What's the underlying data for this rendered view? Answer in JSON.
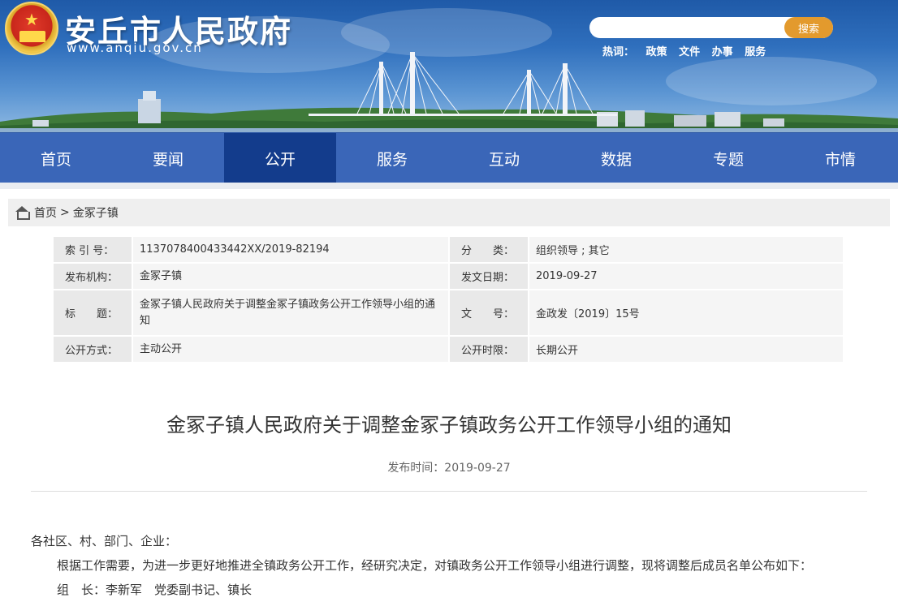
{
  "header": {
    "site_title": "安丘市人民政府",
    "site_url": "www.anqiu.gov.cn",
    "search_placeholder": "",
    "search_button": "搜索",
    "hot_words_label": "热词：",
    "hot_words": [
      "政策",
      "文件",
      "办事",
      "服务"
    ]
  },
  "nav": {
    "items": [
      "首页",
      "要闻",
      "公开",
      "服务",
      "互动",
      "数据",
      "专题",
      "市情"
    ],
    "active_index": 2
  },
  "breadcrumb": {
    "home": "首页",
    "separator": ">",
    "current": "金冢子镇"
  },
  "info": {
    "rows": [
      {
        "l1": "索 引 号：",
        "v1": "1137078400433442XX/2019-82194",
        "l2": "分　　类：",
        "v2": "组织领导 ; 其它"
      },
      {
        "l1": "发布机构：",
        "v1": "金冢子镇",
        "l2": "发文日期：",
        "v2": "2019-09-27"
      },
      {
        "l1": "标　　题：",
        "v1": "金冢子镇人民政府关于调整金冢子镇政务公开工作领导小组的通知",
        "l2": "文　　号：",
        "v2": "金政发〔2019〕15号"
      },
      {
        "l1": "公开方式：",
        "v1": "主动公开",
        "l2": "公开时限：",
        "v2": "长期公开"
      }
    ]
  },
  "article": {
    "title": "金冢子镇人民政府关于调整金冢子镇政务公开工作领导小组的通知",
    "publish_time": "发布时间：2019-09-27",
    "salutation": "各社区、村、部门、企业：",
    "paragraph1": "根据工作需要，为进一步更好地推进全镇政务公开工作，经研究决定，对镇政务公开工作领导小组进行调整，现将调整后成员名单公布如下：",
    "paragraph2": "组　长：李新军　党委副书记、镇长"
  },
  "colors": {
    "nav_bg": "#3a66b8",
    "nav_active": "#133c8c",
    "search_button": "#e39a2d"
  }
}
